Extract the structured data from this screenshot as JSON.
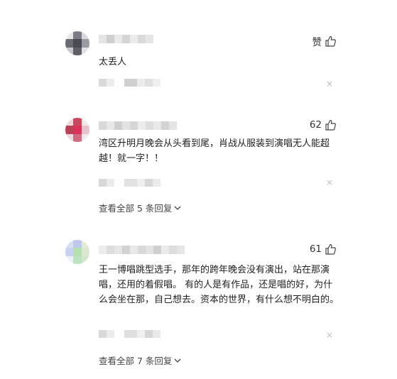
{
  "comments": [
    {
      "like_label": "赞",
      "text": "太丢人",
      "close": "×",
      "avatar_colors": [
        "#e8e8e8",
        "#7b7b85",
        "#d9d9dc",
        "#6a6a72",
        "#4a4a52",
        "#9a9aa2",
        "#c6c6cc",
        "#5f5f66",
        "#e2e2e4"
      ],
      "name_blur": [
        "#e4e4e4",
        "#cfcfcf",
        "#e9e9e9",
        "#d4d4d4",
        "#ebebeb",
        "#dadada",
        "#e6e6e6"
      ],
      "meta_blur": [
        "#dadada",
        "#ececec",
        "#d0d0d0",
        "#ebebeb",
        "#e0e0e0",
        "#efefef"
      ]
    },
    {
      "like_label": "62",
      "text": "湾区升明月晚会从头看到尾，肖战从服装到演唱无人能超越！就一字！！",
      "close": "×",
      "avatar_colors": [
        "#f1d6dc",
        "#c8485e",
        "#f3e6e9",
        "#b84258",
        "#d9335b",
        "#e9c3cc",
        "#f0d9de",
        "#cf6b80",
        "#f6e9ec"
      ],
      "name_blur": [
        "#d9d9d9",
        "#e8e8e8",
        "#cfcfcf",
        "#e3e3e3",
        "#d6d6d6",
        "#ececec",
        "#dedede",
        "#e9e9e9",
        "#d3d3d3",
        "#e4e4e4"
      ],
      "meta_blur": [
        "#d8d8d8",
        "#ebebeb",
        "#e1e1e1",
        "#efefef",
        "#d7d7d7",
        "#eaeaea"
      ],
      "replies_label": "查看全部 5 条回复"
    },
    {
      "like_label": "61",
      "text": "王一博唱跳型选手，那年的跨年晚会没有演出，站在那演唱，还用的着假唱。 有的人是有作品，还是唱的好，为什么会坐在那，自己想去。资本的世界，有什么想不明白的。",
      "close": "×",
      "avatar_colors": [
        "#d9dff2",
        "#bfc7ea",
        "#e2ecd4",
        "#c9d2ee",
        "#b7e0b0",
        "#dbe8cf",
        "#ecf0f8",
        "#bde2c0",
        "#d2e6ca"
      ],
      "name_blur": [
        "#ececec",
        "#dcdcdc",
        "#e5e5e5",
        "#d2d2d2",
        "#e8e8e8",
        "#d9d9d9",
        "#e3e3e3",
        "#cfcfcf",
        "#ebebeb",
        "#dddddd",
        "#e6e6e6"
      ],
      "meta_blur": [
        "#d9d9d9",
        "#ececec",
        "#dfdfdf",
        "#f0f0f0",
        "#d6d6d6",
        "#e9e9e9"
      ],
      "replies_label": "查看全部 7 条回复"
    }
  ]
}
